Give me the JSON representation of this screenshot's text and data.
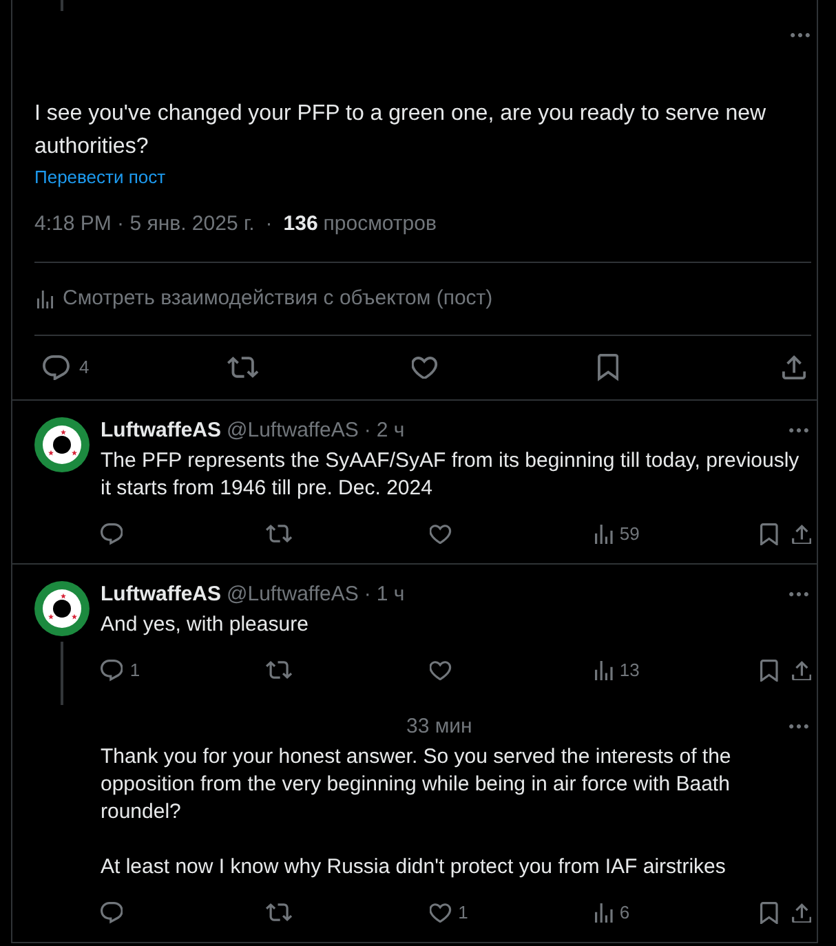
{
  "main_post": {
    "thread_line_above": true,
    "text": "I see you've changed your PFP to a green one, are you ready to serve new authorities?",
    "translate_link": "Перевести пост",
    "timestamp": "4:18 PM · 5 янв. 2025 г.",
    "separator": "·",
    "views_count": "136",
    "views_label": "просмотров",
    "engagements_link": "Смотреть взаимодействия с объектом (пост)",
    "actions": [
      {
        "kind": "reply",
        "count": "4"
      },
      {
        "kind": "repost"
      },
      {
        "kind": "like"
      },
      {
        "kind": "bookmark"
      },
      {
        "kind": "share"
      }
    ]
  },
  "replies": [
    {
      "author_name": "LuftwaffeAS",
      "handle": "@LuftwaffeAS",
      "separator": "·",
      "time": "2 ч",
      "text": "The PFP represents the SyAAF/SyAF from its beginning till today, previously it starts from 1946 till pre. Dec. 2024",
      "thread_line_above": false,
      "thread_continues": false,
      "actions": [
        {
          "kind": "reply"
        },
        {
          "kind": "repost"
        },
        {
          "kind": "like"
        },
        {
          "kind": "views",
          "count": "59"
        },
        {
          "kind": "bookmark"
        },
        {
          "kind": "share"
        }
      ]
    },
    {
      "author_name": "LuftwaffeAS",
      "handle": "@LuftwaffeAS",
      "separator": "·",
      "time": "1 ч",
      "text": "And yes, with pleasure",
      "thread_line_above": false,
      "thread_continues": true,
      "actions": [
        {
          "kind": "reply",
          "count": "1"
        },
        {
          "kind": "repost"
        },
        {
          "kind": "like"
        },
        {
          "kind": "views",
          "count": "13"
        },
        {
          "kind": "bookmark"
        },
        {
          "kind": "share"
        }
      ]
    },
    {
      "time": "33 мин",
      "text": "Thank you for your honest answer. So you served the interests of the opposition from the very beginning while being in air force with Baath roundel?\n\nAt least now I know why Russia didn't protect you from IAF airstrikes",
      "thread_line_above": true,
      "thread_continues": false,
      "actions": [
        {
          "kind": "reply"
        },
        {
          "kind": "repost"
        },
        {
          "kind": "like",
          "count": "1"
        },
        {
          "kind": "views",
          "count": "6"
        },
        {
          "kind": "bookmark"
        },
        {
          "kind": "share"
        }
      ]
    }
  ]
}
